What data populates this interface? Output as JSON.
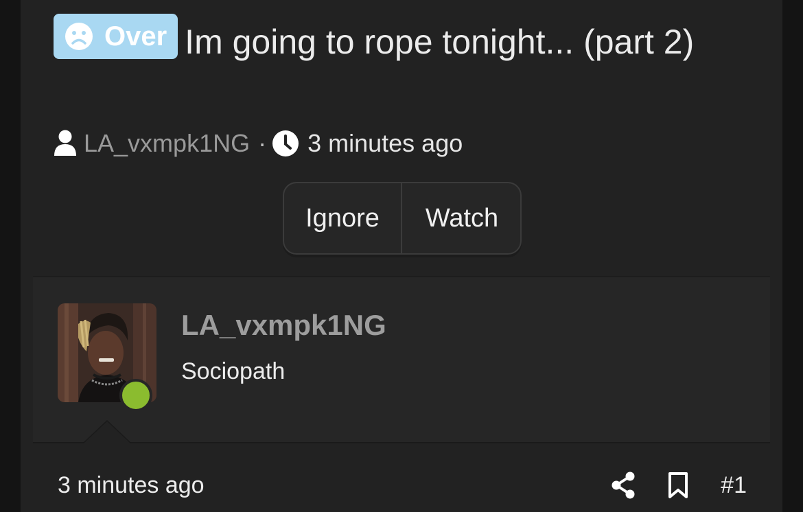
{
  "thread": {
    "prefix_label": "Over",
    "prefix_color": "#a9d8f2",
    "prefix_icon": "sad-face-icon",
    "title": "Im going to rope tonight... (part 2)",
    "author": "LA_vxmpk1NG",
    "separator": "·",
    "posted": "3 minutes ago"
  },
  "actions": {
    "ignore_label": "Ignore",
    "watch_label": "Watch"
  },
  "post": {
    "username": "LA_vxmpk1NG",
    "user_title": "Sociopath",
    "online_color": "#8bbc2f",
    "time": "3 minutes ago",
    "share_icon": "share-icon",
    "bookmark_icon": "bookmark-icon",
    "number": "#1"
  }
}
